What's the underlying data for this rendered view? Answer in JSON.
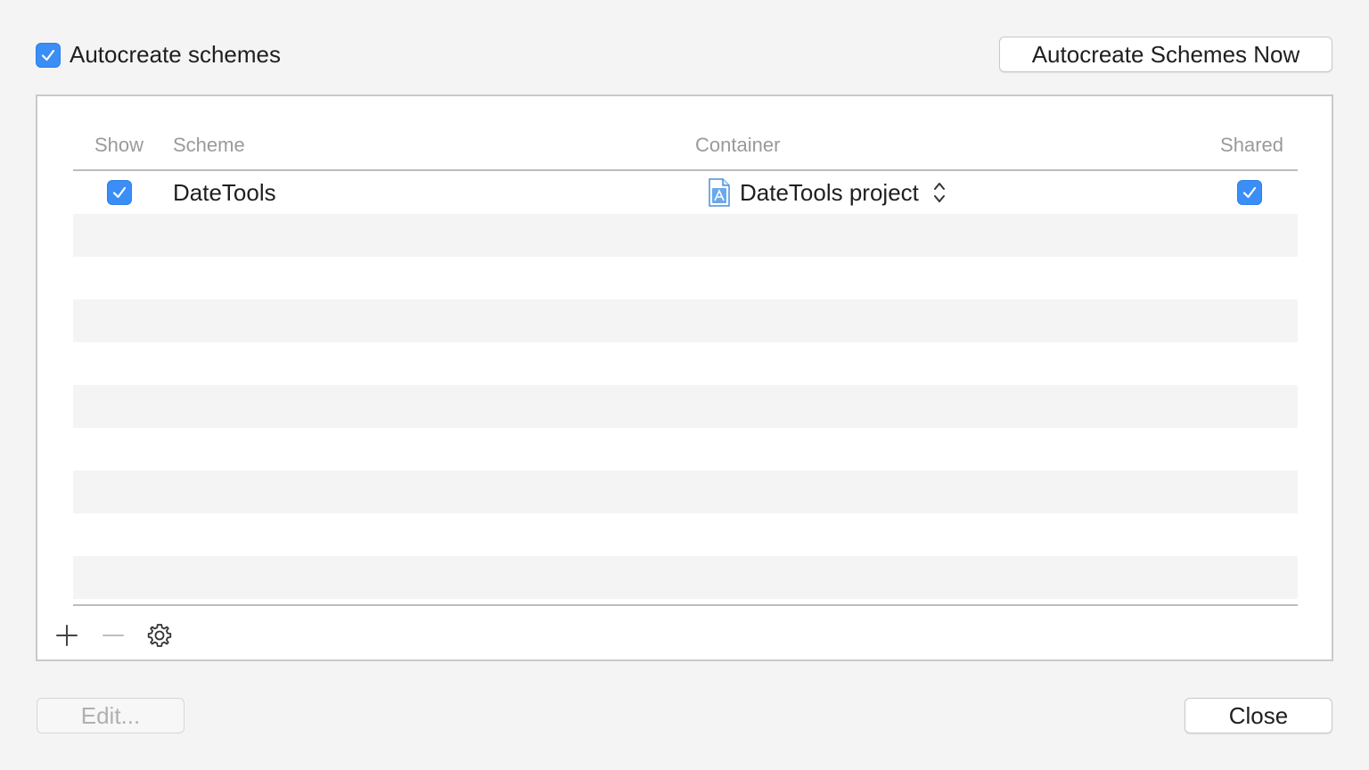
{
  "autocreate": {
    "checkbox_checked": true,
    "label": "Autocreate schemes",
    "now_button": "Autocreate Schemes Now"
  },
  "table": {
    "headers": {
      "show": "Show",
      "scheme": "Scheme",
      "container": "Container",
      "shared": "Shared"
    },
    "rows": [
      {
        "show": true,
        "scheme": "DateTools",
        "container": "DateTools project",
        "shared": true
      }
    ]
  },
  "toolbar": {
    "add_icon": "plus-icon",
    "remove_icon": "minus-icon",
    "settings_icon": "gear-icon"
  },
  "buttons": {
    "edit": "Edit...",
    "close": "Close"
  },
  "colors": {
    "accent": "#3a8ef6",
    "panel_bg": "#ffffff",
    "window_bg": "#f4f4f4",
    "stripe": "#f4f4f4",
    "header_text": "#9a9a9a"
  }
}
